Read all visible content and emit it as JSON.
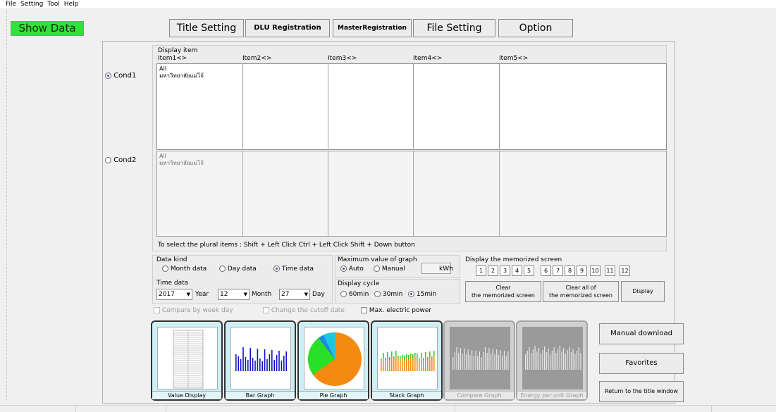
{
  "menu": [
    "File",
    "Setting",
    "Tool",
    "Help"
  ],
  "show_data": "Show Data",
  "top_buttons": {
    "title_setting": "Title Setting",
    "dlu_registration": "DLU Registration",
    "master_registration": "MasterRegistration",
    "file_setting": "File Setting",
    "option": "Option"
  },
  "display_item": {
    "group_label": "Display item",
    "headers": [
      "Item1<>",
      "Item2<>",
      "Item3<>",
      "Item4<>",
      "Item5<>"
    ],
    "cond1": {
      "label": "Cond1",
      "selected": true,
      "lines": [
        "All",
        "มหาวิทยาลัยแม่โจ้"
      ]
    },
    "cond2": {
      "label": "Cond2",
      "selected": false,
      "lines": [
        "All",
        "มหาวิทยาลัยแม่โจ้"
      ]
    },
    "hint": "To select the plural items : Shift + Left Click  Ctrl + Left Click  Shift + Down button"
  },
  "data_kind": {
    "label": "Data kind",
    "options": [
      "Month data",
      "Day data",
      "Time data"
    ],
    "selected": "Time data"
  },
  "time_data": {
    "label": "Time data",
    "year": "2017",
    "year_label": "Year",
    "month": "12",
    "month_label": "Month",
    "day": "27",
    "day_label": "Day"
  },
  "max_value": {
    "label": "Maximum value of graph",
    "auto": "Auto",
    "manual": "Manual",
    "unit": "kWh",
    "selected": "Auto",
    "value": ""
  },
  "display_cycle": {
    "label": "Display cycle",
    "options": [
      "60min",
      "30min",
      "15min"
    ],
    "selected": "15min"
  },
  "memorized": {
    "label": "Display the memorized screen",
    "numbers": [
      "1",
      "2",
      "3",
      "4",
      "5",
      "6",
      "7",
      "8",
      "9",
      "10",
      "11",
      "12"
    ],
    "clear_line1": "Clear",
    "clear_line2": "the memorized screen",
    "clear_all_line1": "Clear all of",
    "clear_all_line2": "the memorized screen",
    "display": "Display"
  },
  "checkboxes": {
    "compare_week": "Compare by week day",
    "cutoff": "Change the cutoff date",
    "max_power": "Max. electric power"
  },
  "graphs": [
    {
      "label": "Value Display",
      "enabled": true,
      "icon": "table-thumbnail"
    },
    {
      "label": "Bar Graph",
      "enabled": true,
      "icon": "bar-chart-thumbnail"
    },
    {
      "label": "Pie Graph",
      "enabled": true,
      "icon": "pie-chart-thumbnail"
    },
    {
      "label": "Stack Graph",
      "enabled": true,
      "icon": "stack-chart-thumbnail"
    },
    {
      "label": "Compare Graph",
      "enabled": false,
      "icon": "compare-chart-thumbnail"
    },
    {
      "label": "Energy per unit Graph",
      "enabled": false,
      "icon": "energy-chart-thumbnail"
    }
  ],
  "right_buttons": {
    "manual_download": "Manual download",
    "favorites": "Favorites",
    "return": "Return to the title window"
  },
  "colors": {
    "show_data_green": "#2fe339",
    "thumb_bg": "#cdeff5",
    "bar_blue": "#1111cc",
    "pie_orange": "#f58a12",
    "pie_green": "#28e028",
    "pie_cyan": "#14c8e8"
  }
}
